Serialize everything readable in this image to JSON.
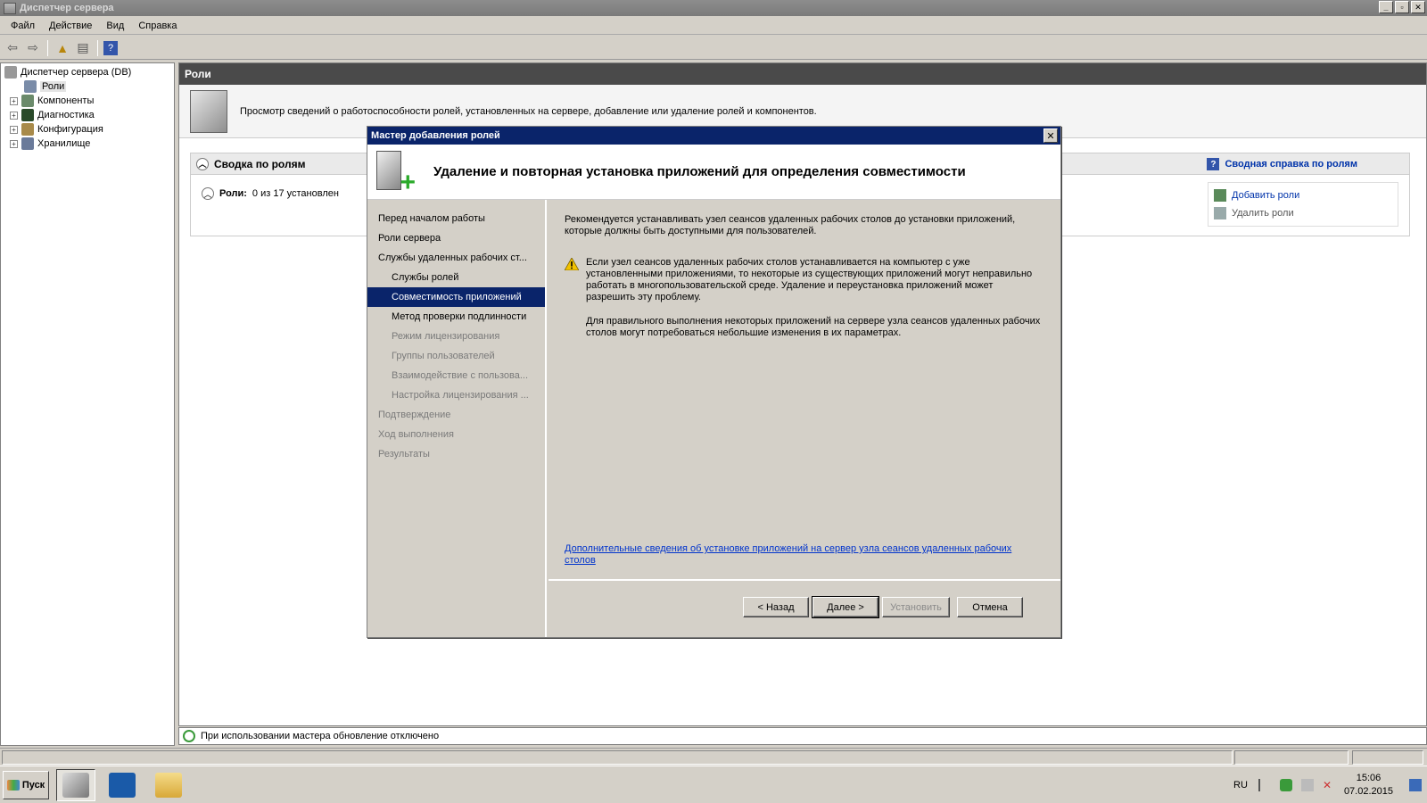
{
  "window": {
    "title": "Диспетчер сервера"
  },
  "menu": [
    "Файл",
    "Действие",
    "Вид",
    "Справка"
  ],
  "tree": {
    "root": "Диспетчер сервера (DB)",
    "items": [
      "Роли",
      "Компоненты",
      "Диагностика",
      "Конфигурация",
      "Хранилище"
    ]
  },
  "main": {
    "header": "Роли",
    "intro": "Просмотр сведений о работоспособности ролей, установленных на сервере, добавление или удаление ролей и компонентов.",
    "summary_title": "Сводка по ролям",
    "summary_help": "Сводная справка по ролям",
    "roles_label": "Роли:",
    "roles_count": "0 из 17 установлен",
    "add_roles": "Добавить роли",
    "remove_roles": "Удалить роли",
    "status": "При использовании мастера обновление отключено"
  },
  "wizard": {
    "title": "Мастер добавления ролей",
    "heading": "Удаление и повторная установка приложений для определения совместимости",
    "nav": [
      {
        "label": "Перед началом работы",
        "sub": false,
        "state": "normal"
      },
      {
        "label": "Роли сервера",
        "sub": false,
        "state": "normal"
      },
      {
        "label": "Службы удаленных рабочих ст...",
        "sub": false,
        "state": "normal"
      },
      {
        "label": "Службы ролей",
        "sub": true,
        "state": "normal"
      },
      {
        "label": "Совместимость приложений",
        "sub": true,
        "state": "active"
      },
      {
        "label": "Метод проверки подлинности",
        "sub": true,
        "state": "normal"
      },
      {
        "label": "Режим лицензирования",
        "sub": true,
        "state": "dim"
      },
      {
        "label": "Группы пользователей",
        "sub": true,
        "state": "dim"
      },
      {
        "label": "Взаимодействие с пользова...",
        "sub": true,
        "state": "dim"
      },
      {
        "label": "Настройка лицензирования ...",
        "sub": true,
        "state": "dim"
      },
      {
        "label": "Подтверждение",
        "sub": false,
        "state": "dim"
      },
      {
        "label": "Ход выполнения",
        "sub": false,
        "state": "dim"
      },
      {
        "label": "Результаты",
        "sub": false,
        "state": "dim"
      }
    ],
    "text1": "Рекомендуется устанавливать узел сеансов удаленных рабочих столов до установки приложений, которые должны быть доступными для пользователей.",
    "warning": "Если узел сеансов удаленных рабочих столов устанавливается на компьютер с уже установленными приложениями, то некоторые из существующих приложений могут неправильно работать в многопользовательской среде. Удаление и переустановка приложений может разрешить эту проблему.",
    "text2": "Для правильного выполнения некоторых приложений на сервере узла сеансов удаленных рабочих столов могут потребоваться небольшие изменения в их параметрах.",
    "link": "Дополнительные сведения об установке приложений на сервер узла сеансов удаленных рабочих столов",
    "buttons": {
      "back": "< Назад",
      "next": "Далее >",
      "install": "Установить",
      "cancel": "Отмена"
    }
  },
  "taskbar": {
    "start": "Пуск",
    "lang": "RU",
    "time": "15:06",
    "date": "07.02.2015"
  },
  "colors": {
    "selection": "#0a246a",
    "link": "#0033cc",
    "dim": "#7a7a7a"
  }
}
